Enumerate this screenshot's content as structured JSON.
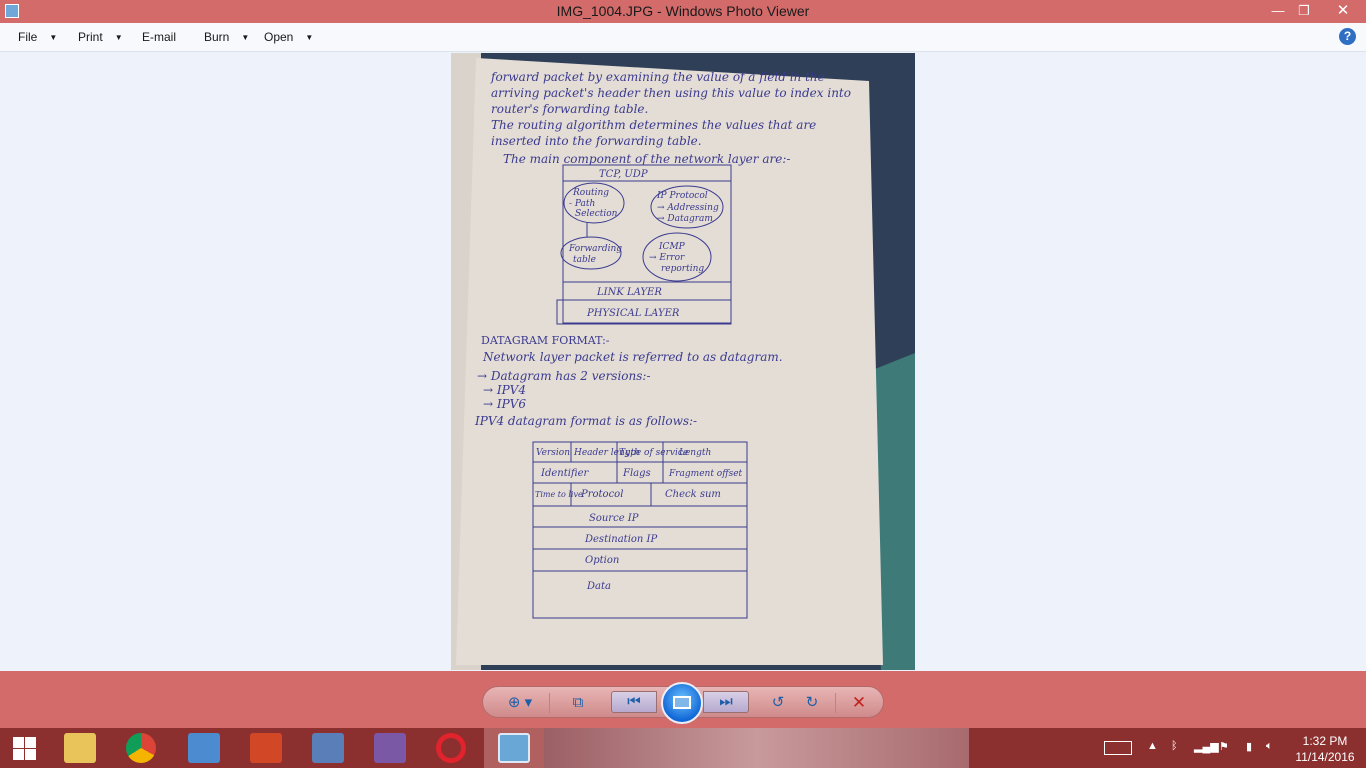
{
  "window": {
    "title": "IMG_1004.JPG - Windows Photo Viewer",
    "minimize_glyph": "—",
    "maximize_glyph": "❐",
    "close_glyph": "✕"
  },
  "menu": {
    "file": "File",
    "print": "Print",
    "email": "E-mail",
    "burn": "Burn",
    "open": "Open",
    "help": "?"
  },
  "photo": {
    "paragraph1": [
      "forward packet by examining the value of a field in the",
      "arriving packet's header then using this value to index into",
      "router's forwarding table.",
      "The routing algorithm determines the values that are",
      "inserted into the forwarding table.",
      "The main component of the network layer are:-"
    ],
    "diagram": {
      "top": "TCP, UDP",
      "routing": [
        "Routing",
        "- Path",
        "Selection"
      ],
      "ip": [
        "IP Protocol",
        "→ Addressing",
        "→ Datagram"
      ],
      "fwd": [
        "Forwarding",
        "table"
      ],
      "icmp": [
        "ICMP",
        "→ Error",
        "reporting"
      ],
      "link": "LINK LAYER",
      "physical": "PHYSICAL LAYER"
    },
    "heading": "DATAGRAM FORMAT:-",
    "paragraph2": [
      "Network layer packet is referred to as datagram.",
      "→ Datagram has 2 versions:-",
      "→ IPV4",
      "→ IPV6",
      "IPV4 datagram format is as follows:-"
    ],
    "table": {
      "version": "Version",
      "header_length": "Header length",
      "type_of_service": "Type of service",
      "length": "Length",
      "identifier": "Identifier",
      "flags": "Flags",
      "fragment_offset": "Fragment offset",
      "ttl": "Time to live",
      "protocol": "Protocol",
      "checksum": "Check sum",
      "source_ip": "Source IP",
      "destination_ip": "Destination IP",
      "option": "Option",
      "data": "Data"
    }
  },
  "controls": {
    "zoom_icon": "magnifier-icon",
    "zoom_glyph": "⊕ ▾",
    "fit_glyph": "⧉",
    "prev_glyph": "⏮",
    "next_glyph": "⏭",
    "rotate_left_glyph": "↺",
    "rotate_right_glyph": "↻",
    "delete_glyph": "✕"
  },
  "taskbar": {
    "clock_time": "1:32 PM",
    "clock_date": "11/14/2016"
  },
  "colors": {
    "titlebar": "#d36b6b",
    "taskbar": "#8c2f2f",
    "ink": "#3b3a8f"
  }
}
